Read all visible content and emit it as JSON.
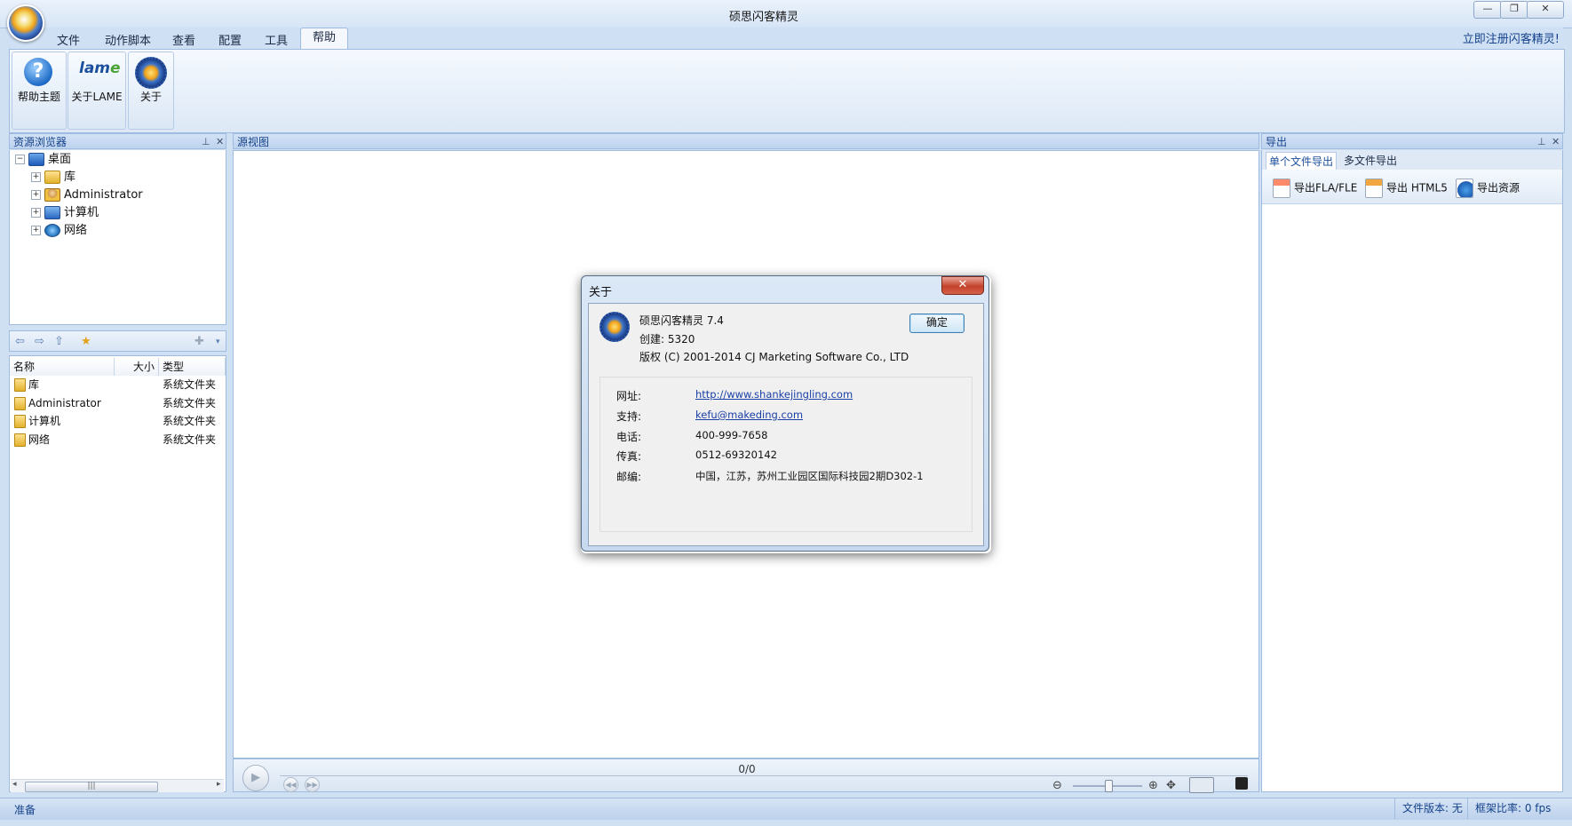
{
  "app": {
    "title": "硕思闪客精灵",
    "register_link": "立即注册闪客精灵!"
  },
  "ribbon": {
    "tabs": [
      "文件",
      "动作脚本",
      "查看",
      "配置",
      "工具"
    ],
    "active_tab": "帮助",
    "buttons": [
      {
        "label": "帮助主题",
        "icon": "help-icon"
      },
      {
        "label": "关于LAME",
        "icon": "lame-icon",
        "icon_text": "lam",
        "icon_text_accent": "e"
      },
      {
        "label": "关于",
        "icon": "about-icon"
      }
    ]
  },
  "caption_buttons": {
    "minimize": "—",
    "restore": "❐",
    "close": "✕"
  },
  "resource_browser": {
    "title": "资源浏览器",
    "tree": [
      {
        "label": "桌面",
        "icon": "desktop-icon",
        "level": 0
      },
      {
        "label": "库",
        "icon": "folder-icon",
        "level": 1
      },
      {
        "label": "Administrator",
        "icon": "user-folder-icon",
        "level": 1
      },
      {
        "label": "计算机",
        "icon": "computer-icon",
        "level": 1
      },
      {
        "label": "网络",
        "icon": "network-icon",
        "level": 1
      }
    ],
    "columns": [
      "名称",
      "大小",
      "类型"
    ],
    "files": [
      {
        "name": "库",
        "size": "",
        "type": "系统文件夹"
      },
      {
        "name": "Administrator",
        "size": "",
        "type": "系统文件夹"
      },
      {
        "name": "计算机",
        "size": "",
        "type": "系统文件夹"
      },
      {
        "name": "网络",
        "size": "",
        "type": "系统文件夹"
      }
    ]
  },
  "source_view": {
    "title": "源视图",
    "frame_counter": "0/0"
  },
  "export_panel": {
    "title": "导出",
    "tabs": [
      "单个文件导出",
      "多文件导出"
    ],
    "tools": [
      {
        "label": "导出FLA/FLE",
        "icon": "fla-export-icon"
      },
      {
        "label": "导出 HTML5",
        "icon": "html5-export-icon"
      },
      {
        "label": "导出资源",
        "icon": "resource-export-icon"
      }
    ]
  },
  "status": {
    "text": "准备",
    "file_version": "文件版本: 无",
    "frame_rate": "框架比率: 0 fps"
  },
  "about_dialog": {
    "title": "关于",
    "close_glyph": "✕",
    "product": "硕思闪客精灵 7.4",
    "build": "创建: 5320",
    "copyright": "版权 (C) 2001-2014 CJ Marketing Software Co., LTD",
    "ok_label": "确定",
    "info": [
      {
        "label": "网址:",
        "value": "http://www.shankejingling.com",
        "link": true
      },
      {
        "label": "支持:",
        "value": "kefu@makeding.com",
        "link": true
      },
      {
        "label": "电话:",
        "value": "400-999-7658",
        "link": false
      },
      {
        "label": "传真:",
        "value": "0512-69320142",
        "link": false
      },
      {
        "label": "邮编:",
        "value": "中国，江苏，苏州工业园区国际科技园2期D302-1",
        "link": false
      }
    ]
  }
}
